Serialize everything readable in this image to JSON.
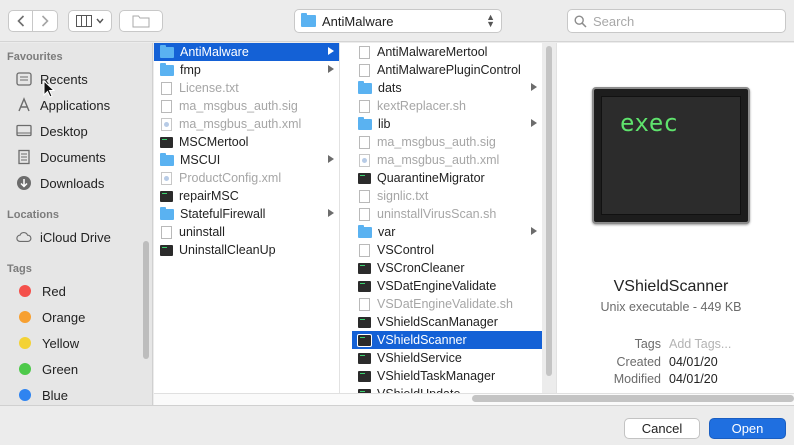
{
  "toolbar": {
    "path_label": "AntiMalware",
    "search_placeholder": "Search"
  },
  "sidebar": {
    "sections": {
      "favourites": "Favourites",
      "locations": "Locations",
      "tags": "Tags"
    },
    "favourites": [
      {
        "label": "Recents",
        "icon": "recents-icon"
      },
      {
        "label": "Applications",
        "icon": "applications-icon"
      },
      {
        "label": "Desktop",
        "icon": "desktop-icon"
      },
      {
        "label": "Documents",
        "icon": "documents-icon"
      },
      {
        "label": "Downloads",
        "icon": "downloads-icon"
      }
    ],
    "locations": [
      {
        "label": "iCloud Drive",
        "icon": "cloud-icon"
      }
    ],
    "tags": [
      {
        "label": "Red",
        "color": "#f4504b"
      },
      {
        "label": "Orange",
        "color": "#f7a031"
      },
      {
        "label": "Yellow",
        "color": "#f3d236"
      },
      {
        "label": "Green",
        "color": "#4dc94a"
      },
      {
        "label": "Blue",
        "color": "#2f84f0"
      }
    ]
  },
  "column1": [
    {
      "label": "AntiMalware",
      "type": "folder",
      "selected": true,
      "dim": false,
      "arrow": true
    },
    {
      "label": "fmp",
      "type": "folder",
      "selected": false,
      "dim": false,
      "arrow": true
    },
    {
      "label": "License.txt",
      "type": "doc",
      "selected": false,
      "dim": true,
      "arrow": false
    },
    {
      "label": "ma_msgbus_auth.sig",
      "type": "doc",
      "selected": false,
      "dim": true,
      "arrow": false
    },
    {
      "label": "ma_msgbus_auth.xml",
      "type": "xml",
      "selected": false,
      "dim": true,
      "arrow": false
    },
    {
      "label": "MSCMertool",
      "type": "exec",
      "selected": false,
      "dim": false,
      "arrow": false
    },
    {
      "label": "MSCUI",
      "type": "folder",
      "selected": false,
      "dim": false,
      "arrow": true
    },
    {
      "label": "ProductConfig.xml",
      "type": "xml",
      "selected": false,
      "dim": true,
      "arrow": false
    },
    {
      "label": "repairMSC",
      "type": "exec",
      "selected": false,
      "dim": false,
      "arrow": false
    },
    {
      "label": "StatefulFirewall",
      "type": "folder",
      "selected": false,
      "dim": false,
      "arrow": true
    },
    {
      "label": "uninstall",
      "type": "doc",
      "selected": false,
      "dim": false,
      "arrow": false
    },
    {
      "label": "UninstallCleanUp",
      "type": "exec",
      "selected": false,
      "dim": false,
      "arrow": false
    }
  ],
  "column2": [
    {
      "label": "AntiMalwareMertool",
      "type": "doc",
      "selected": false,
      "dim": false,
      "arrow": false
    },
    {
      "label": "AntiMalwarePluginControl",
      "type": "doc",
      "selected": false,
      "dim": false,
      "arrow": false
    },
    {
      "label": "dats",
      "type": "folder",
      "selected": false,
      "dim": false,
      "arrow": true
    },
    {
      "label": "kextReplacer.sh",
      "type": "doc",
      "selected": false,
      "dim": true,
      "arrow": false
    },
    {
      "label": "lib",
      "type": "folder",
      "selected": false,
      "dim": false,
      "arrow": true
    },
    {
      "label": "ma_msgbus_auth.sig",
      "type": "doc",
      "selected": false,
      "dim": true,
      "arrow": false
    },
    {
      "label": "ma_msgbus_auth.xml",
      "type": "xml",
      "selected": false,
      "dim": true,
      "arrow": false
    },
    {
      "label": "QuarantineMigrator",
      "type": "exec",
      "selected": false,
      "dim": false,
      "arrow": false
    },
    {
      "label": "signlic.txt",
      "type": "doc",
      "selected": false,
      "dim": true,
      "arrow": false
    },
    {
      "label": "uninstallVirusScan.sh",
      "type": "doc",
      "selected": false,
      "dim": true,
      "arrow": false
    },
    {
      "label": "var",
      "type": "folder",
      "selected": false,
      "dim": false,
      "arrow": true
    },
    {
      "label": "VSControl",
      "type": "doc",
      "selected": false,
      "dim": false,
      "arrow": false
    },
    {
      "label": "VSCronCleaner",
      "type": "exec",
      "selected": false,
      "dim": false,
      "arrow": false
    },
    {
      "label": "VSDatEngineValidate",
      "type": "exec",
      "selected": false,
      "dim": false,
      "arrow": false
    },
    {
      "label": "VSDatEngineValidate.sh",
      "type": "doc",
      "selected": false,
      "dim": true,
      "arrow": false
    },
    {
      "label": "VShieldScanManager",
      "type": "exec",
      "selected": false,
      "dim": false,
      "arrow": false
    },
    {
      "label": "VShieldScanner",
      "type": "exec",
      "selected": true,
      "dim": false,
      "arrow": false
    },
    {
      "label": "VShieldService",
      "type": "exec",
      "selected": false,
      "dim": false,
      "arrow": false
    },
    {
      "label": "VShieldTaskManager",
      "type": "exec",
      "selected": false,
      "dim": false,
      "arrow": false
    },
    {
      "label": "VShieldUpdate",
      "type": "exec",
      "selected": false,
      "dim": false,
      "arrow": false
    }
  ],
  "preview": {
    "icon_text": "exec",
    "name": "VShieldScanner",
    "kind": "Unix executable - 449 KB",
    "tags_label": "Tags",
    "tags_placeholder": "Add Tags...",
    "created_label": "Created",
    "created_value": "04/01/20",
    "modified_label": "Modified",
    "modified_value": "04/01/20"
  },
  "footer": {
    "cancel": "Cancel",
    "open": "Open"
  }
}
